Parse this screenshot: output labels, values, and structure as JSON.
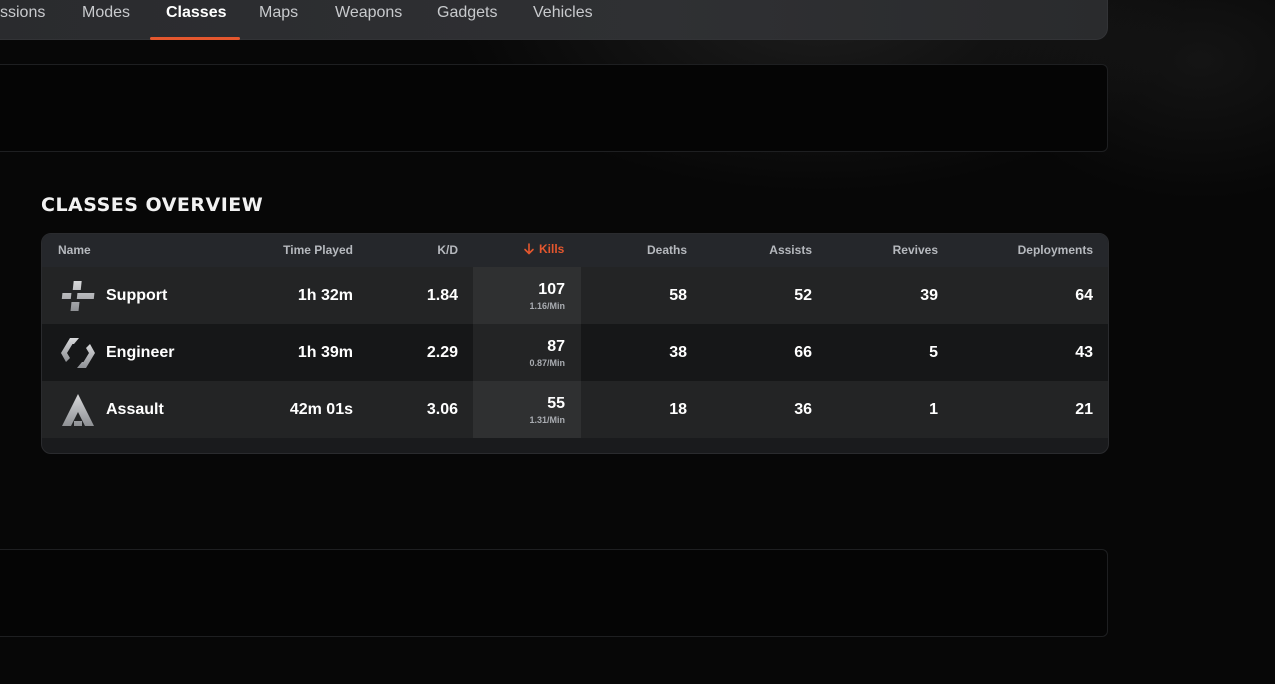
{
  "nav": {
    "tabs": [
      {
        "label": "ssions"
      },
      {
        "label": "Modes"
      },
      {
        "label": "Classes",
        "active": true
      },
      {
        "label": "Maps"
      },
      {
        "label": "Weapons"
      },
      {
        "label": "Gadgets"
      },
      {
        "label": "Vehicles"
      }
    ]
  },
  "overview": {
    "title": "CLASSES OVERVIEW",
    "columns": {
      "name": "Name",
      "time_played": "Time Played",
      "kd": "K/D",
      "kills": "Kills",
      "deaths": "Deaths",
      "assists": "Assists",
      "revives": "Revives",
      "deployments": "Deployments"
    },
    "sort": {
      "column": "kills",
      "direction": "desc",
      "icon": "arrow-down-icon"
    },
    "rows": [
      {
        "name": "Support",
        "icon": "support-class-icon",
        "time_played": "1h 32m",
        "kd": "1.84",
        "kills": "107",
        "kills_per_min": "1.16/Min",
        "deaths": "58",
        "assists": "52",
        "revives": "39",
        "deployments": "64"
      },
      {
        "name": "Engineer",
        "icon": "engineer-class-icon",
        "time_played": "1h 39m",
        "kd": "2.29",
        "kills": "87",
        "kills_per_min": "0.87/Min",
        "deaths": "38",
        "assists": "66",
        "revives": "5",
        "deployments": "43"
      },
      {
        "name": "Assault",
        "icon": "assault-class-icon",
        "time_played": "42m 01s",
        "kd": "3.06",
        "kills": "55",
        "kills_per_min": "1.31/Min",
        "deaths": "18",
        "assists": "36",
        "revives": "1",
        "deployments": "21"
      }
    ]
  },
  "colors": {
    "accent": "#e4572e",
    "background": "#070707",
    "table_header": "#25272b"
  }
}
